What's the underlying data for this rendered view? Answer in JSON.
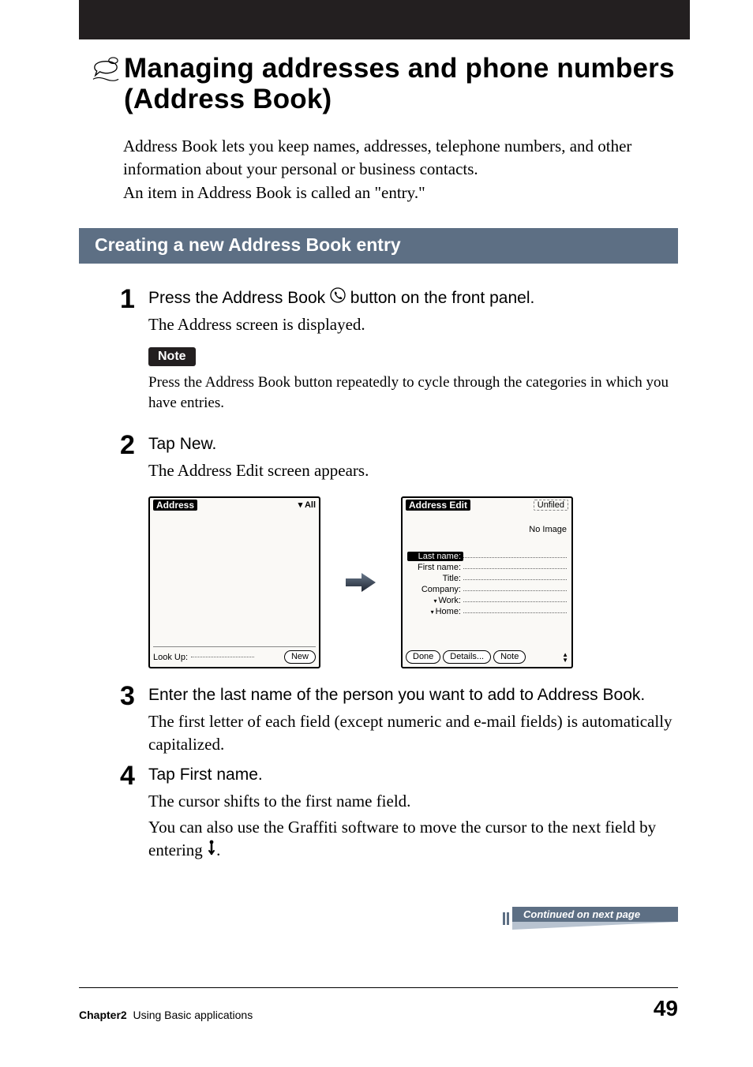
{
  "title": "Managing addresses and phone numbers (Address Book)",
  "intro_p1": "Address Book lets you keep names, addresses, telephone numbers, and other information about your personal or business contacts.",
  "intro_p2": "An item in Address Book is called an \"entry.\"",
  "section_heading": "Creating a new Address Book entry",
  "steps": {
    "s1": {
      "num": "1",
      "title_before": "Press the Address Book ",
      "title_after": " button on the front panel.",
      "body": "The Address screen is displayed.",
      "note_label": "Note",
      "note_text": "Press the Address Book button repeatedly to cycle through the categories in which you have entries."
    },
    "s2": {
      "num": "2",
      "title": "Tap New.",
      "body": "The Address Edit screen appears."
    },
    "s3": {
      "num": "3",
      "title": "Enter the last name of the person you want to add to Address Book.",
      "body": "The first letter of each field (except numeric and e-mail fields) is automatically capitalized."
    },
    "s4": {
      "num": "4",
      "title": "Tap First name.",
      "body1": "The cursor shifts to the first name field.",
      "body2_before": "You can also use the Graffiti software to move the cursor to the next field by entering ",
      "body2_after": "."
    }
  },
  "screen_left": {
    "title": "Address",
    "category": "All",
    "lookup_label": "Look Up:",
    "new_btn": "New"
  },
  "screen_right": {
    "title": "Address Edit",
    "category": "Unfiled",
    "no_image": "No Image",
    "fields": {
      "last": "Last name:",
      "first": "First name:",
      "titlef": "Title:",
      "company": "Company:",
      "work": "Work:",
      "home": "Home:"
    },
    "buttons": {
      "done": "Done",
      "details": "Details...",
      "note": "Note"
    }
  },
  "continued": "Continued on next page",
  "footer": {
    "chapter": "Chapter2",
    "chapter_sub": "Using Basic applications",
    "page": "49"
  }
}
